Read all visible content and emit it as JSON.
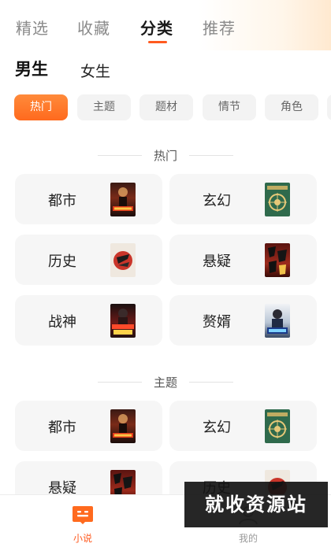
{
  "top_tabs": [
    {
      "label": "精选"
    },
    {
      "label": "收藏"
    },
    {
      "label": "分类"
    },
    {
      "label": "推荐"
    }
  ],
  "active_top_tab": "分类",
  "gender_tabs": [
    {
      "label": "男生"
    },
    {
      "label": "女生"
    }
  ],
  "active_gender_tab": "男生",
  "filter_chips": [
    {
      "label": "热门"
    },
    {
      "label": "主题"
    },
    {
      "label": "题材"
    },
    {
      "label": "情节"
    },
    {
      "label": "角色"
    }
  ],
  "active_filter_chip": "热门",
  "sections": [
    {
      "title": "热门",
      "cards": [
        {
          "label": "都市",
          "cover_text": "超级仙尊"
        },
        {
          "label": "玄幻",
          "cover_text": "万古仙王"
        },
        {
          "label": "历史",
          "cover_text": "大秦"
        },
        {
          "label": "悬疑",
          "cover_text": "北派盗墓"
        },
        {
          "label": "战神",
          "cover_text": "龙王归来"
        },
        {
          "label": "赘婿",
          "cover_text": "上门龙婿"
        }
      ]
    },
    {
      "title": "主题",
      "cards": [
        {
          "label": "都市",
          "cover_text": "超级仙尊"
        },
        {
          "label": "玄幻",
          "cover_text": "万古仙王"
        },
        {
          "label": "悬疑",
          "cover_text": "北派盗墓"
        },
        {
          "label": "历史",
          "cover_text": "大秦"
        }
      ]
    }
  ],
  "bottom_nav": [
    {
      "label": "小说",
      "icon": "book-icon"
    },
    {
      "label": "我的",
      "icon": "profile-icon"
    }
  ],
  "active_bottom_nav": "小说",
  "watermark": "就收资源站",
  "colors": {
    "accent": "#ff5a1f",
    "chip_active": "#ff6a1e",
    "card_bg": "#f6f6f6",
    "chip_bg": "#f3f3f3"
  }
}
